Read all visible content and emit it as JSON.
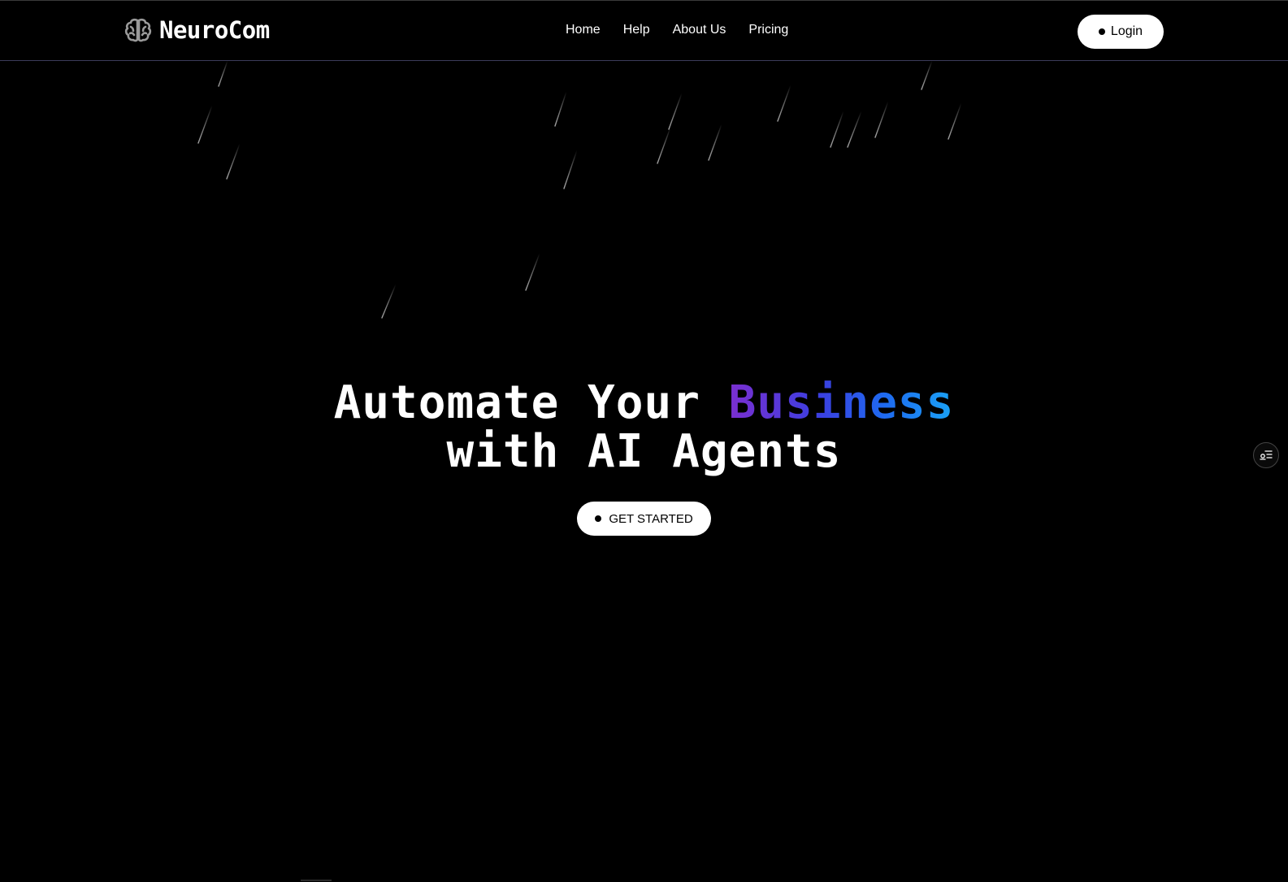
{
  "brand": {
    "name": "NeuroCom",
    "icon": "brain-icon"
  },
  "nav": {
    "links": [
      "Home",
      "Help",
      "About Us",
      "Pricing"
    ]
  },
  "login": {
    "label": "Login"
  },
  "hero": {
    "line1_prefix": "Automate Your ",
    "line1_highlight": "Business",
    "line2": "with AI Agents",
    "cta_label": "GET STARTED"
  },
  "side_widget": {
    "icon": "settings-list-icon"
  },
  "colors": {
    "background": "#000000",
    "text": "#ffffff",
    "gradient_start": "#7b2fd0",
    "gradient_mid": "#1e6bf0",
    "gradient_end": "#1aa3f5"
  }
}
